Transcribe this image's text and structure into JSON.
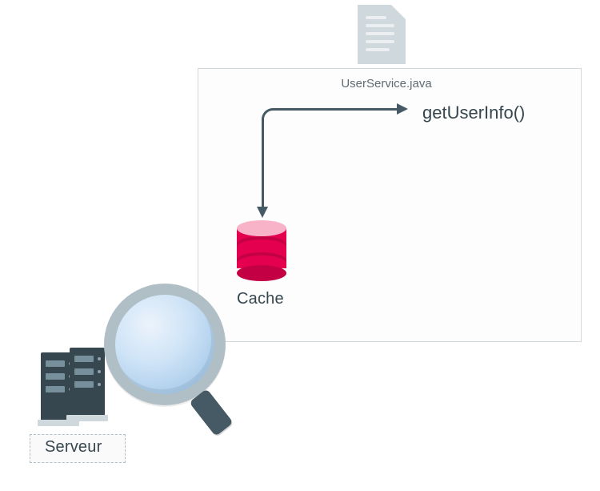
{
  "file": {
    "name": "UserService.java"
  },
  "method": {
    "label": "getUserInfo()"
  },
  "cache": {
    "label": "Cache"
  },
  "server": {
    "label": "Serveur"
  },
  "arrow": {
    "from": "Cache",
    "to": "getUserInfo()"
  }
}
